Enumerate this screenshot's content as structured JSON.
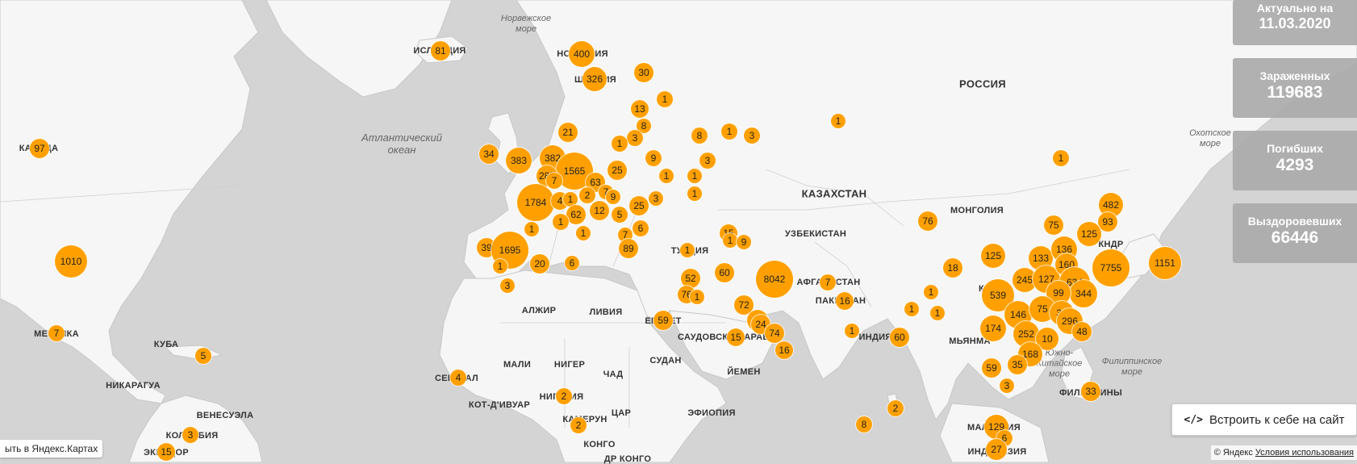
{
  "stats": {
    "date_label": "Актуально на",
    "date_value": "11.03.2020",
    "infected_label": "Зараженных",
    "infected_value": "119683",
    "deaths_label": "Погибших",
    "deaths_value": "4293",
    "recovered_label": "Выздоровевших",
    "recovered_value": "66446"
  },
  "embed_button": {
    "label": "Встроить к себе на сайт",
    "icon": "code-icon"
  },
  "open_link": "ыть в Яндекс.Картах",
  "copyright": {
    "text": "© Яндекс",
    "terms": "Условия использования"
  },
  "colors": {
    "marker": "#ffa000",
    "land": "#f6f6f6",
    "water": "#d4d4d4",
    "panel": "#aaaaaa"
  },
  "country_labels": [
    "КАНАДА",
    "РОССИЯ",
    "КАЗАХСТАН",
    "МОНГОЛИЯ",
    "УЗБЕКИСТАН",
    "АФГАНИСТАН",
    "ПАКИСТАН",
    "ИНДИЯ",
    "МЬЯНМА",
    "КНДР",
    "ФИЛИППИНЫ",
    "АЛЖИР",
    "ЛИВИЯ",
    "ЕГИПЕТ",
    "МАЛИ",
    "НИГЕР",
    "ЧАД",
    "СУДАН",
    "НИГЕРИЯ",
    "КОТ-Д'ИВУАР",
    "ЦАР",
    "ЭФИОПИЯ",
    "КАМЕРУН",
    "КОНГО",
    "ДР КОНГО",
    "ЙЕМЕН",
    "САУДОВСКАЯ АРАВИЯ",
    "ТУРЦИЯ",
    "МЕКСИКА",
    "КУБА",
    "НИКАРАГУА",
    "ВЕНЕСУЭЛА",
    "КОЛУМБИЯ",
    "ЭКВАДОР",
    "СЕНЕГАЛ",
    "ИСЛАНДИЯ",
    "НОРВЕГИЯ",
    "ШВЕЦИЯ",
    "МАЛАЙЗИЯ",
    "ИНДОНЕЗИЯ",
    "КИТАЙ"
  ],
  "sea_labels": [
    "Норвежское\nморе",
    "Атлантический\nокеан",
    "Охотское\nморе",
    "Филиппинское\nморе",
    "Южно-\nКитайское\nморе"
  ],
  "markers": [
    {
      "v": "97"
    },
    {
      "v": "1010"
    },
    {
      "v": "7"
    },
    {
      "v": "5"
    },
    {
      "v": "3"
    },
    {
      "v": "15"
    },
    {
      "v": "81"
    },
    {
      "v": "400"
    },
    {
      "v": "326"
    },
    {
      "v": "30"
    },
    {
      "v": "1"
    },
    {
      "v": "13"
    },
    {
      "v": "8"
    },
    {
      "v": "3"
    },
    {
      "v": "1"
    },
    {
      "v": "21"
    },
    {
      "v": "34"
    },
    {
      "v": "383"
    },
    {
      "v": "382"
    },
    {
      "v": "1565"
    },
    {
      "v": "285"
    },
    {
      "v": "7"
    },
    {
      "v": "25"
    },
    {
      "v": "63"
    },
    {
      "v": "7"
    },
    {
      "v": "9"
    },
    {
      "v": "1784"
    },
    {
      "v": "4"
    },
    {
      "v": "1"
    },
    {
      "v": "2"
    },
    {
      "v": "62"
    },
    {
      "v": "1"
    },
    {
      "v": "12"
    },
    {
      "v": "5"
    },
    {
      "v": "25"
    },
    {
      "v": "3"
    },
    {
      "v": "1"
    },
    {
      "v": "1"
    },
    {
      "v": "39"
    },
    {
      "v": "1695"
    },
    {
      "v": "1"
    },
    {
      "v": "20"
    },
    {
      "v": "6"
    },
    {
      "v": "3"
    },
    {
      "v": "7"
    },
    {
      "v": "6"
    },
    {
      "v": "89"
    },
    {
      "v": "9"
    },
    {
      "v": "1"
    },
    {
      "v": "1"
    },
    {
      "v": "8"
    },
    {
      "v": "1"
    },
    {
      "v": "3"
    },
    {
      "v": "3"
    },
    {
      "v": "1"
    },
    {
      "v": "1"
    },
    {
      "v": "15"
    },
    {
      "v": "1"
    },
    {
      "v": "9"
    },
    {
      "v": "1"
    },
    {
      "v": "52"
    },
    {
      "v": "60"
    },
    {
      "v": "76"
    },
    {
      "v": "1"
    },
    {
      "v": "8042"
    },
    {
      "v": "7"
    },
    {
      "v": "72"
    },
    {
      "v": "3"
    },
    {
      "v": "24"
    },
    {
      "v": "15"
    },
    {
      "v": "74"
    },
    {
      "v": "16"
    },
    {
      "v": "59"
    },
    {
      "v": "16"
    },
    {
      "v": "76"
    },
    {
      "v": "18"
    },
    {
      "v": "1"
    },
    {
      "v": "1"
    },
    {
      "v": "1"
    },
    {
      "v": "60"
    },
    {
      "v": "4"
    },
    {
      "v": "2"
    },
    {
      "v": "2"
    },
    {
      "v": "8"
    },
    {
      "v": "2"
    },
    {
      "v": "125"
    },
    {
      "v": "539"
    },
    {
      "v": "75"
    },
    {
      "v": "245"
    },
    {
      "v": "133"
    },
    {
      "v": "136"
    },
    {
      "v": "127"
    },
    {
      "v": "160"
    },
    {
      "v": "634"
    },
    {
      "v": "344"
    },
    {
      "v": "99"
    },
    {
      "v": "146"
    },
    {
      "v": "75"
    },
    {
      "v": "31"
    },
    {
      "v": "296"
    },
    {
      "v": "174"
    },
    {
      "v": "252"
    },
    {
      "v": "10"
    },
    {
      "v": "48"
    },
    {
      "v": "168"
    },
    {
      "v": "35"
    },
    {
      "v": "59"
    },
    {
      "v": "3"
    },
    {
      "v": "129"
    },
    {
      "v": "6"
    },
    {
      "v": "27"
    },
    {
      "v": "33"
    },
    {
      "v": "482"
    },
    {
      "v": "93"
    },
    {
      "v": "125"
    },
    {
      "v": "7755"
    },
    {
      "v": "1151"
    },
    {
      "v": "1"
    },
    {
      "v": "1"
    }
  ]
}
